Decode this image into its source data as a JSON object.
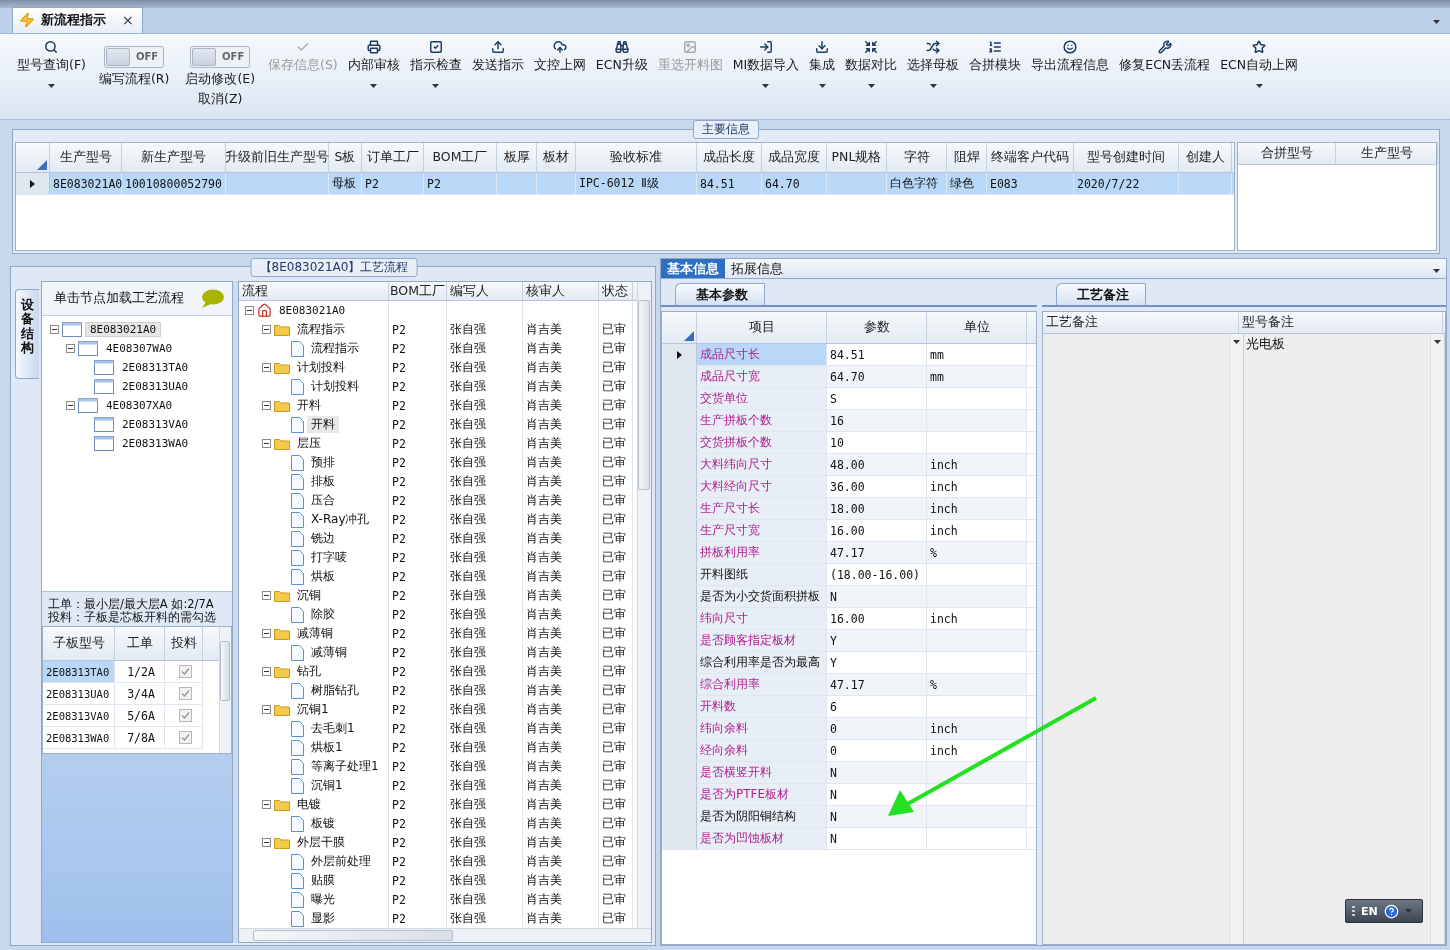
{
  "tab": {
    "title": "新流程指示",
    "close": "×",
    "selected": true
  },
  "toolbar": [
    {
      "kind": "button",
      "label": "型号查询(F)",
      "dropdown": true,
      "disabled": false
    },
    {
      "kind": "toggle",
      "label": "编写流程(R)",
      "switch_text": "OFF",
      "on": false
    },
    {
      "kind": "toggle",
      "label": "启动修改(E)",
      "label2": "取消(Z)",
      "switch_text": "OFF",
      "on": false
    },
    {
      "kind": "button",
      "label": "保存信息(S)",
      "dropdown": false,
      "disabled": true
    },
    {
      "kind": "button",
      "label": "内部审核",
      "dropdown": true,
      "disabled": false
    },
    {
      "kind": "button",
      "label": "指示检查",
      "dropdown": true,
      "disabled": false
    },
    {
      "kind": "button",
      "label": "发送指示",
      "dropdown": false,
      "disabled": false
    },
    {
      "kind": "button",
      "label": "文控上网",
      "dropdown": false,
      "disabled": false
    },
    {
      "kind": "button",
      "label": "ECN升级",
      "dropdown": false,
      "disabled": false
    },
    {
      "kind": "button",
      "label": "重选开料图",
      "dropdown": false,
      "disabled": true
    },
    {
      "kind": "button",
      "label": "MI数据导入",
      "dropdown": true,
      "disabled": false
    },
    {
      "kind": "button",
      "label": "集成",
      "dropdown": true,
      "disabled": false
    },
    {
      "kind": "button",
      "label": "数据对比",
      "dropdown": true,
      "disabled": false
    },
    {
      "kind": "button",
      "label": "选择母板",
      "dropdown": true,
      "disabled": false
    },
    {
      "kind": "button",
      "label": "合拼模块",
      "dropdown": false,
      "disabled": false
    },
    {
      "kind": "button",
      "label": "导出流程信息",
      "dropdown": false,
      "disabled": false
    },
    {
      "kind": "button",
      "label": "修复ECN丢流程",
      "dropdown": false,
      "disabled": false
    },
    {
      "kind": "button",
      "label": "ECN自动上网",
      "dropdown": true,
      "disabled": false
    }
  ],
  "main_info": {
    "title": "主要信息",
    "columns": [
      {
        "header": "生产型号",
        "value": "8E083021A0"
      },
      {
        "header": "新生产型号",
        "value": "10010800052790"
      },
      {
        "header": "升级前旧生产型号"
      },
      {
        "header": "S板",
        "value": "母板"
      },
      {
        "header": "订单工厂",
        "value": "P2"
      },
      {
        "header": "BOM工厂",
        "value": "P2"
      },
      {
        "header": "板厚"
      },
      {
        "header": "板材"
      },
      {
        "header": "验收标准",
        "value": "IPC-6012 Ⅱ级"
      },
      {
        "header": "成品长度",
        "value": "84.51"
      },
      {
        "header": "成品宽度",
        "value": "64.70"
      },
      {
        "header": "PNL规格"
      },
      {
        "header": "字符",
        "value": "白色字符"
      },
      {
        "header": "阻焊",
        "value": "绿色"
      },
      {
        "header": "终端客户代码",
        "value": "E083"
      },
      {
        "header": "型号创建时间",
        "value": "2020/7/22"
      },
      {
        "header": "创建人"
      }
    ],
    "row_selected": true,
    "merge_columns": [
      "合拼型号",
      "生产型号"
    ]
  },
  "process": {
    "title": "【8E083021A0】工艺流程",
    "side_tab": "设备结构",
    "hint": "单击节点加载工艺流程",
    "structure_tree": [
      {
        "label": "8E083021A0",
        "expanded": true,
        "selected": true,
        "children": [
          {
            "label": "4E08307WA0",
            "expanded": true,
            "selected": false,
            "children": [
              {
                "label": "2E08313TA0",
                "selected": false
              },
              {
                "label": "2E08313UA0",
                "selected": false
              }
            ]
          },
          {
            "label": "4E08307XA0",
            "expanded": true,
            "selected": false,
            "children": [
              {
                "label": "2E08313VA0",
                "selected": false
              },
              {
                "label": "2E08313WA0",
                "selected": false
              }
            ]
          }
        ]
      }
    ],
    "notes": [
      "工单：最小层/最大层A 如:2/7A",
      "投料：子板是芯板开料的需勾选"
    ],
    "sub_columns": [
      "子板型号",
      "工单",
      "投料"
    ],
    "sub_rows": [
      {
        "model": "2E08313TA0",
        "order": "1/2A",
        "feed": true,
        "selected": true
      },
      {
        "model": "2E08313UA0",
        "order": "3/4A",
        "feed": true,
        "selected": false
      },
      {
        "model": "2E08313VA0",
        "order": "5/6A",
        "feed": true,
        "selected": false
      },
      {
        "model": "2E08313WA0",
        "order": "7/8A",
        "feed": true,
        "selected": false
      }
    ],
    "flow_columns": [
      "流程",
      "BOM工厂",
      "编写人",
      "核审人",
      "状态"
    ],
    "flow_tree": [
      {
        "name": "8E083021A0",
        "expanded": true,
        "selected": false,
        "children": [
          {
            "name": "流程指示",
            "bom": "P2",
            "writer": "张自强",
            "reviewer": "肖吉美",
            "status": "已审",
            "expanded": true,
            "selected": false,
            "children": [
              {
                "name": "流程指示",
                "bom": "P2",
                "writer": "张自强",
                "reviewer": "肖吉美",
                "status": "已审",
                "selected": false
              }
            ]
          },
          {
            "name": "计划投料",
            "bom": "P2",
            "writer": "张自强",
            "reviewer": "肖吉美",
            "status": "已审",
            "expanded": true,
            "selected": false,
            "children": [
              {
                "name": "计划投料",
                "bom": "P2",
                "writer": "张自强",
                "reviewer": "肖吉美",
                "status": "已审",
                "selected": false
              }
            ]
          },
          {
            "name": "开料",
            "bom": "P2",
            "writer": "张自强",
            "reviewer": "肖吉美",
            "status": "已审",
            "expanded": true,
            "selected": false,
            "children": [
              {
                "name": "开料",
                "bom": "P2",
                "writer": "张自强",
                "reviewer": "肖吉美",
                "status": "已审",
                "selected": true
              }
            ]
          },
          {
            "name": "层压",
            "bom": "P2",
            "writer": "张自强",
            "reviewer": "肖吉美",
            "status": "已审",
            "expanded": true,
            "selected": false,
            "children": [
              {
                "name": "预排",
                "bom": "P2",
                "writer": "张自强",
                "reviewer": "肖吉美",
                "status": "已审",
                "selected": false
              },
              {
                "name": "排板",
                "bom": "P2",
                "writer": "张自强",
                "reviewer": "肖吉美",
                "status": "已审",
                "selected": false
              },
              {
                "name": "压合",
                "bom": "P2",
                "writer": "张自强",
                "reviewer": "肖吉美",
                "status": "已审",
                "selected": false
              },
              {
                "name": "X-Ray冲孔",
                "bom": "P2",
                "writer": "张自强",
                "reviewer": "肖吉美",
                "status": "已审",
                "selected": false
              },
              {
                "name": "铣边",
                "bom": "P2",
                "writer": "张自强",
                "reviewer": "肖吉美",
                "status": "已审",
                "selected": false
              },
              {
                "name": "打字唛",
                "bom": "P2",
                "writer": "张自强",
                "reviewer": "肖吉美",
                "status": "已审",
                "selected": false
              },
              {
                "name": "烘板",
                "bom": "P2",
                "writer": "张自强",
                "reviewer": "肖吉美",
                "status": "已审",
                "selected": false
              }
            ]
          },
          {
            "name": "沉铜",
            "bom": "P2",
            "writer": "张自强",
            "reviewer": "肖吉美",
            "status": "已审",
            "expanded": true,
            "selected": false,
            "children": [
              {
                "name": "除胶",
                "bom": "P2",
                "writer": "张自强",
                "reviewer": "肖吉美",
                "status": "已审",
                "selected": false
              }
            ]
          },
          {
            "name": "减薄铜",
            "bom": "P2",
            "writer": "张自强",
            "reviewer": "肖吉美",
            "status": "已审",
            "expanded": true,
            "selected": false,
            "children": [
              {
                "name": "减薄铜",
                "bom": "P2",
                "writer": "张自强",
                "reviewer": "肖吉美",
                "status": "已审",
                "selected": false
              }
            ]
          },
          {
            "name": "钻孔",
            "bom": "P2",
            "writer": "张自强",
            "reviewer": "肖吉美",
            "status": "已审",
            "expanded": true,
            "selected": false,
            "children": [
              {
                "name": "树脂钻孔",
                "bom": "P2",
                "writer": "张自强",
                "reviewer": "肖吉美",
                "status": "已审",
                "selected": false
              }
            ]
          },
          {
            "name": "沉铜1",
            "bom": "P2",
            "writer": "张自强",
            "reviewer": "肖吉美",
            "status": "已审",
            "expanded": true,
            "selected": false,
            "children": [
              {
                "name": "去毛刺1",
                "bom": "P2",
                "writer": "张自强",
                "reviewer": "肖吉美",
                "status": "已审",
                "selected": false
              },
              {
                "name": "烘板1",
                "bom": "P2",
                "writer": "张自强",
                "reviewer": "肖吉美",
                "status": "已审",
                "selected": false
              },
              {
                "name": "等离子处理1",
                "bom": "P2",
                "writer": "张自强",
                "reviewer": "肖吉美",
                "status": "已审",
                "selected": false
              },
              {
                "name": "沉铜1",
                "bom": "P2",
                "writer": "张自强",
                "reviewer": "肖吉美",
                "status": "已审",
                "selected": false
              }
            ]
          },
          {
            "name": "电镀",
            "bom": "P2",
            "writer": "张自强",
            "reviewer": "肖吉美",
            "status": "已审",
            "expanded": true,
            "selected": false,
            "children": [
              {
                "name": "板镀",
                "bom": "P2",
                "writer": "张自强",
                "reviewer": "肖吉美",
                "status": "已审",
                "selected": false
              }
            ]
          },
          {
            "name": "外层干膜",
            "bom": "P2",
            "writer": "张自强",
            "reviewer": "肖吉美",
            "status": "已审",
            "expanded": true,
            "selected": false,
            "children": [
              {
                "name": "外层前处理",
                "bom": "P2",
                "writer": "张自强",
                "reviewer": "肖吉美",
                "status": "已审",
                "selected": false
              },
              {
                "name": "贴膜",
                "bom": "P2",
                "writer": "张自强",
                "reviewer": "肖吉美",
                "status": "已审",
                "selected": false
              },
              {
                "name": "曝光",
                "bom": "P2",
                "writer": "张自强",
                "reviewer": "肖吉美",
                "status": "已审",
                "selected": false
              },
              {
                "name": "显影",
                "bom": "P2",
                "writer": "张自强",
                "reviewer": "肖吉美",
                "status": "已审",
                "selected": false
              }
            ]
          }
        ]
      }
    ]
  },
  "details": {
    "tabs": [
      {
        "label": "基本信息",
        "selected": true
      },
      {
        "label": "拓展信息",
        "selected": false
      }
    ],
    "params_tab": "基本参数",
    "param_columns": [
      "项目",
      "参数",
      "单位"
    ],
    "params": [
      {
        "item": "成品尺寸长",
        "value": "84.51",
        "unit": "mm",
        "highlighted": true,
        "selected": true
      },
      {
        "item": "成品尺寸宽",
        "value": "64.70",
        "unit": "mm",
        "highlighted": true,
        "selected": false
      },
      {
        "item": "交货单位",
        "value": "S",
        "highlighted": true,
        "selected": false
      },
      {
        "item": "生产拼板个数",
        "value": "16",
        "highlighted": true,
        "selected": false
      },
      {
        "item": "交货拼板个数",
        "value": "10",
        "highlighted": true,
        "selected": false
      },
      {
        "item": "大料纬向尺寸",
        "value": "48.00",
        "unit": "inch",
        "highlighted": true,
        "selected": false
      },
      {
        "item": "大料经向尺寸",
        "value": "36.00",
        "unit": "inch",
        "highlighted": true,
        "selected": false
      },
      {
        "item": "生产尺寸长",
        "value": "18.00",
        "unit": "inch",
        "highlighted": true,
        "selected": false
      },
      {
        "item": "生产尺寸宽",
        "value": "16.00",
        "unit": "inch",
        "highlighted": true,
        "selected": false
      },
      {
        "item": "拼板利用率",
        "value": "47.17",
        "unit": "%",
        "highlighted": true,
        "selected": false
      },
      {
        "item": "开料图纸",
        "value": "(18.00-16.00)",
        "highlighted": false,
        "selected": false
      },
      {
        "item": "是否为小交货面积拼板",
        "value": "N",
        "highlighted": false,
        "selected": false
      },
      {
        "item": "纬向尺寸",
        "value": "16.00",
        "unit": "inch",
        "highlighted": true,
        "selected": false
      },
      {
        "item": "是否顾客指定板材",
        "value": "Y",
        "highlighted": true,
        "selected": false
      },
      {
        "item": "综合利用率是否为最高",
        "value": "Y",
        "highlighted": false,
        "selected": false
      },
      {
        "item": "综合利用率",
        "value": "47.17",
        "unit": "%",
        "highlighted": true,
        "selected": false
      },
      {
        "item": "开料数",
        "value": "6",
        "highlighted": true,
        "selected": false
      },
      {
        "item": "纬向余料",
        "value": "0",
        "unit": "inch",
        "highlighted": true,
        "selected": false
      },
      {
        "item": "经向余料",
        "value": "0",
        "unit": "inch",
        "highlighted": true,
        "selected": false
      },
      {
        "item": "是否横竖开料",
        "value": "N",
        "highlighted": true,
        "selected": false
      },
      {
        "item": "是否为PTFE板材",
        "value": "N",
        "highlighted": true,
        "selected": false
      },
      {
        "item": "是否为阴阳铜结构",
        "value": "N",
        "highlighted": false,
        "selected": false
      },
      {
        "item": "是否为凹蚀板材",
        "value": "N",
        "highlighted": true,
        "selected": false
      }
    ],
    "remarks_tab": "工艺备注",
    "remark_columns": [
      {
        "header": "工艺备注"
      },
      {
        "header": "型号备注",
        "value": "光电板"
      }
    ]
  },
  "ime": {
    "label": "EN"
  }
}
